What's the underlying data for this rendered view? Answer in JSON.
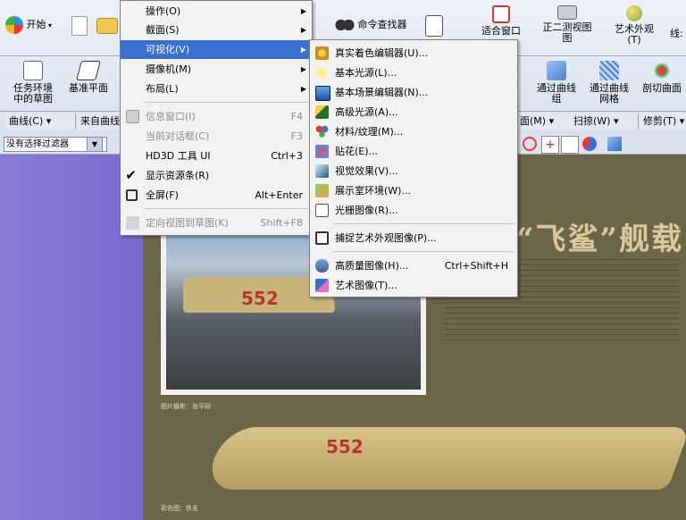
{
  "ribbon": {
    "row1": {
      "start": "开始",
      "command_finder": "命令查找器",
      "fit_window": "适合窗口",
      "dimetric": "正二测视图",
      "art_appearance": "艺术外观",
      "wire_partial": "线:"
    },
    "row2": {
      "task_env_line1": "任务环境",
      "task_env_line2": "中的草图",
      "base_plane": "基准平面",
      "through_curve_group_line1": "通过曲线",
      "through_curve_group_line2": "组",
      "through_curve_mesh_line1": "通过曲线",
      "through_curve_mesh_line2": "网格",
      "section_surface": "剖切曲面"
    },
    "groups": {
      "curve": "曲线(C) ▾",
      "freeform_partial": "来自曲线",
      "sweep": "扫掠(W) ▾",
      "trim": "修剪(T) ▾",
      "m_partial": "面(M) ▾"
    }
  },
  "filter": {
    "value": "没有选择过滤器"
  },
  "left_menu": {
    "items": [
      {
        "label": "操作(O)",
        "arrow": true
      },
      {
        "label": "截面(S)",
        "arrow": true
      },
      {
        "label": "可视化(V)",
        "arrow": true
      },
      {
        "label": "摄像机(M)",
        "arrow": true
      },
      {
        "label": "布局(L)",
        "arrow": true
      },
      {
        "label": "信息窗口(I)",
        "shortcut": "F4"
      },
      {
        "label": "当前对话框(C)",
        "shortcut": "F3"
      },
      {
        "label": "HD3D 工具 UI",
        "shortcut": "Ctrl+3"
      },
      {
        "label": "显示资源条(R)"
      },
      {
        "label": "全屏(F)",
        "shortcut": "Alt+Enter"
      },
      {
        "label": "定向视图到草图(K)",
        "shortcut": "Shift+F8"
      }
    ]
  },
  "right_menu": {
    "items": [
      {
        "label": "真实着色编辑器(U)..."
      },
      {
        "label": "基本光源(L)..."
      },
      {
        "label": "基本场景编辑器(N)..."
      },
      {
        "label": "高级光源(A)..."
      },
      {
        "label": "材料/纹理(M)..."
      },
      {
        "label": "贴花(E)..."
      },
      {
        "label": "视觉效果(V)..."
      },
      {
        "label": "展示室环境(W)..."
      },
      {
        "label": "光栅图像(R)..."
      },
      {
        "label": "捕捉艺术外观图像(P)..."
      },
      {
        "label": "高质量图像(H)...",
        "shortcut": "Ctrl+Shift+H"
      },
      {
        "label": "艺术图像(T)..."
      }
    ]
  },
  "poster": {
    "title": "“飞鲨”舰载",
    "tail_number": "552",
    "caption_top": "图片摄影：张平同",
    "caption_bottom": "彩色图：佚名"
  },
  "colors": {
    "highlight": "#3a6fd2",
    "poster_bg": "#6c6649",
    "title": "#d9c89a",
    "tail_number": "#b7362c"
  }
}
